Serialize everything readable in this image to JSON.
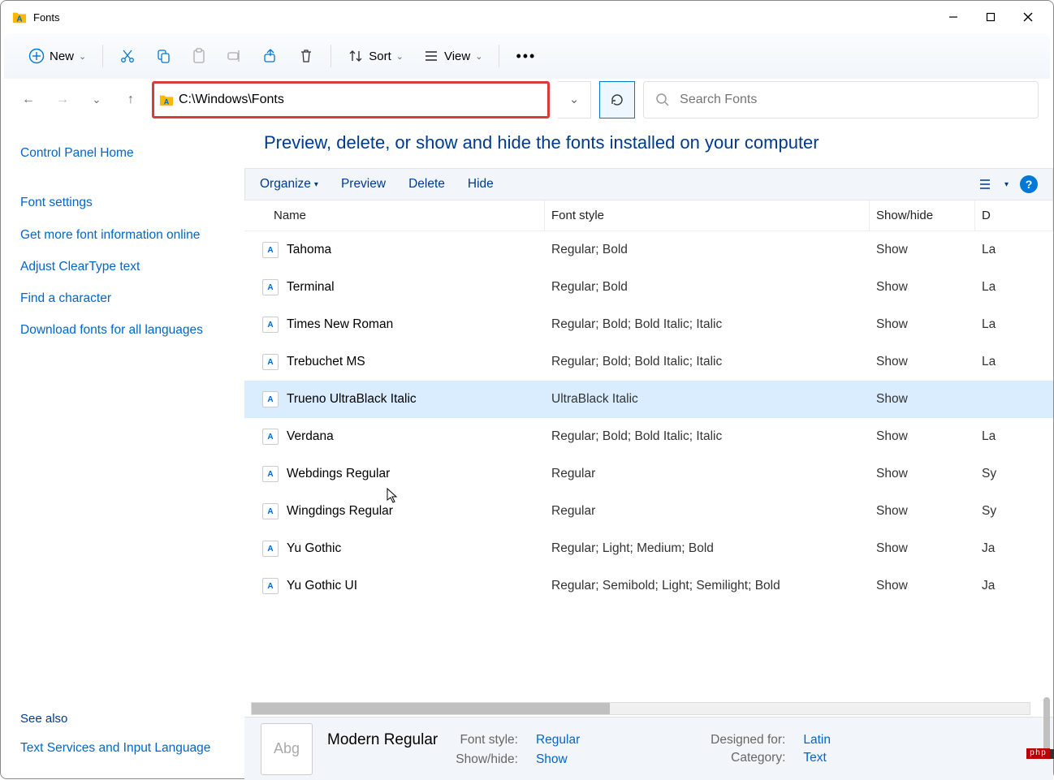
{
  "window": {
    "title": "Fonts"
  },
  "toolbar": {
    "new": "New",
    "sort": "Sort",
    "view": "View"
  },
  "address": {
    "path": "C:\\Windows\\Fonts"
  },
  "search": {
    "placeholder": "Search Fonts"
  },
  "sidebar": {
    "home": "Control Panel Home",
    "items": [
      "Font settings",
      "Get more font information online",
      "Adjust ClearType text",
      "Find a character",
      "Download fonts for all languages"
    ],
    "see_also_label": "See also",
    "see_also_item": "Text Services and Input Language"
  },
  "content": {
    "heading": "Preview, delete, or show and hide the fonts installed on your computer",
    "toolbar": {
      "organize": "Organize",
      "preview": "Preview",
      "delete": "Delete",
      "hide": "Hide"
    },
    "headers": {
      "name": "Name",
      "style": "Font style",
      "show": "Show/hide",
      "de": "D"
    }
  },
  "fonts": [
    {
      "name": "Tahoma",
      "style": "Regular; Bold",
      "show": "Show",
      "de": "La"
    },
    {
      "name": "Terminal",
      "style": "Regular; Bold",
      "show": "Show",
      "de": "La"
    },
    {
      "name": "Times New Roman",
      "style": "Regular; Bold; Bold Italic; Italic",
      "show": "Show",
      "de": "La"
    },
    {
      "name": "Trebuchet MS",
      "style": "Regular; Bold; Bold Italic; Italic",
      "show": "Show",
      "de": "La"
    },
    {
      "name": "Trueno UltraBlack Italic",
      "style": "UltraBlack Italic",
      "show": "Show",
      "de": "",
      "selected": true
    },
    {
      "name": "Verdana",
      "style": "Regular; Bold; Bold Italic; Italic",
      "show": "Show",
      "de": "La"
    },
    {
      "name": "Webdings Regular",
      "style": "Regular",
      "show": "Show",
      "de": "Sy"
    },
    {
      "name": "Wingdings Regular",
      "style": "Regular",
      "show": "Show",
      "de": "Sy"
    },
    {
      "name": "Yu Gothic",
      "style": "Regular; Light; Medium; Bold",
      "show": "Show",
      "de": "Ja"
    },
    {
      "name": "Yu Gothic UI",
      "style": "Regular; Semibold; Light; Semilight; Bold",
      "show": "Show",
      "de": "Ja"
    }
  ],
  "details": {
    "title": "Modern Regular",
    "style_label": "Font style:",
    "style_value": "Regular",
    "show_label": "Show/hide:",
    "show_value": "Show",
    "designed_label": "Designed for:",
    "designed_value": "Latin",
    "category_label": "Category:",
    "category_value": "Text",
    "preview_glyph": "Abg"
  },
  "watermark": "php"
}
